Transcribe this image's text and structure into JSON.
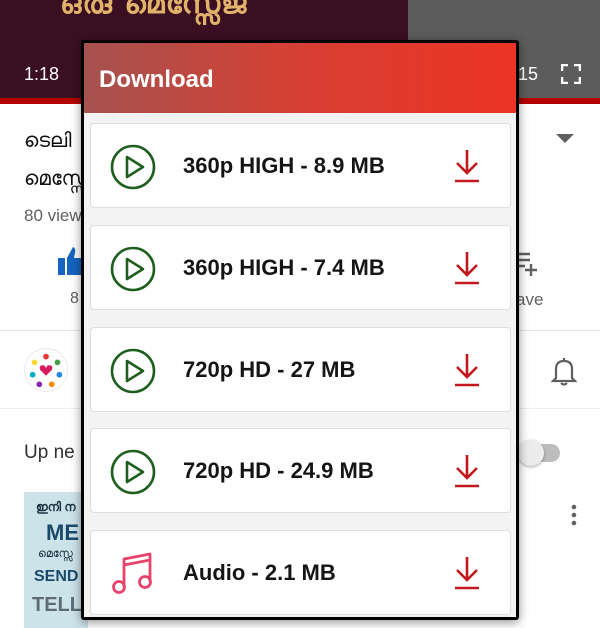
{
  "video": {
    "overlay_title": "ഒരു മെസ്സേജ്",
    "current_time": "1:18",
    "total_time_partial": "15"
  },
  "details": {
    "title_line1": "ടെലി",
    "title_line2": "മെസ്സേ",
    "views": "80 view",
    "like_count": "8",
    "save_label": "ave"
  },
  "up_next": {
    "label": "Up ne",
    "thumbnail_lines": [
      "ഇനി ന",
      "ME",
      "മെസ്സേ",
      "SEND",
      "TELL"
    ]
  },
  "dialog": {
    "title": "Download",
    "options": [
      {
        "label": "360p HIGH - 8.9 MB",
        "icon": "play-circle-icon"
      },
      {
        "label": "360p HIGH - 7.4 MB",
        "icon": "play-circle-icon"
      },
      {
        "label": "720p HD - 27 MB",
        "icon": "play-circle-icon"
      },
      {
        "label": "720p HD - 24.9 MB",
        "icon": "play-circle-icon"
      },
      {
        "label": "Audio - 2.1 MB",
        "icon": "music-note-icon"
      }
    ]
  },
  "colors": {
    "header_gradient_start": "#a5524f",
    "header_gradient_end": "#ec3425",
    "video_icon": "#1e5e1e",
    "audio_icon": "#e8436b",
    "download_arrow": "#c0181c",
    "progress_bar": "#b40000"
  }
}
